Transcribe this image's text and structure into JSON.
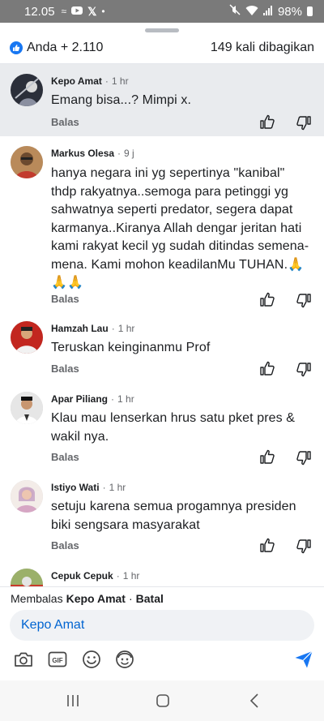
{
  "status_bar": {
    "time": "12.05",
    "notification_icons": [
      "double-tilde-icon",
      "youtube-icon",
      "x-icon",
      "dot-icon"
    ],
    "battery": "98%"
  },
  "sheet": {
    "reactions_label": "Anda + 2.110",
    "shares_label": "149 kali dibagikan"
  },
  "comments": [
    {
      "name": "Kepo Amat",
      "time": "1 hr",
      "text": "Emang bisa...? Mimpi x.",
      "reply": "Balas",
      "highlighted": true
    },
    {
      "name": "Markus Olesa",
      "time": "9 j",
      "text": "hanya negara ini yg sepertinya \"kanibal\" thdp rakyatnya..semoga para petinggi yg sahwatnya seperti predator, segera dapat karmanya..Kiranya Allah dengar jeritan hati kami rakyat kecil yg sudah ditindas semena-mena. Kami mohon keadilanMu TUHAN.🙏🙏🙏",
      "reply": "Balas",
      "highlighted": false
    },
    {
      "name": "Hamzah Lau",
      "time": "1 hr",
      "text": "Teruskan keinginanmu Prof",
      "reply": "Balas",
      "highlighted": false
    },
    {
      "name": "Apar Piliang",
      "time": "1 hr",
      "text": "Klau mau lenserkan hrus satu pket pres & wakil nya.",
      "reply": "Balas",
      "highlighted": false
    },
    {
      "name": "Istiyo Wati",
      "time": "1 hr",
      "text": "setuju karena semua progamnya presiden biki sengsara masyarakat",
      "reply": "Balas",
      "highlighted": false
    },
    {
      "name": "Cepuk Cepuk",
      "time": "1 hr",
      "text": "",
      "reply": "",
      "highlighted": false
    }
  ],
  "reply_bar": {
    "prefix": "Membalas",
    "target": "Kepo Amat",
    "separator": "·",
    "cancel": "Batal"
  },
  "composer": {
    "value": "Kepo Amat"
  },
  "toolbar_icons": [
    "camera-icon",
    "gif-icon",
    "emoji-icon",
    "avatar-sticker-icon",
    "send-icon"
  ],
  "colors": {
    "accent": "#1877f2",
    "mention": "#0064d1",
    "highlight_bg": "#e9ebee",
    "muted": "#65676b"
  }
}
